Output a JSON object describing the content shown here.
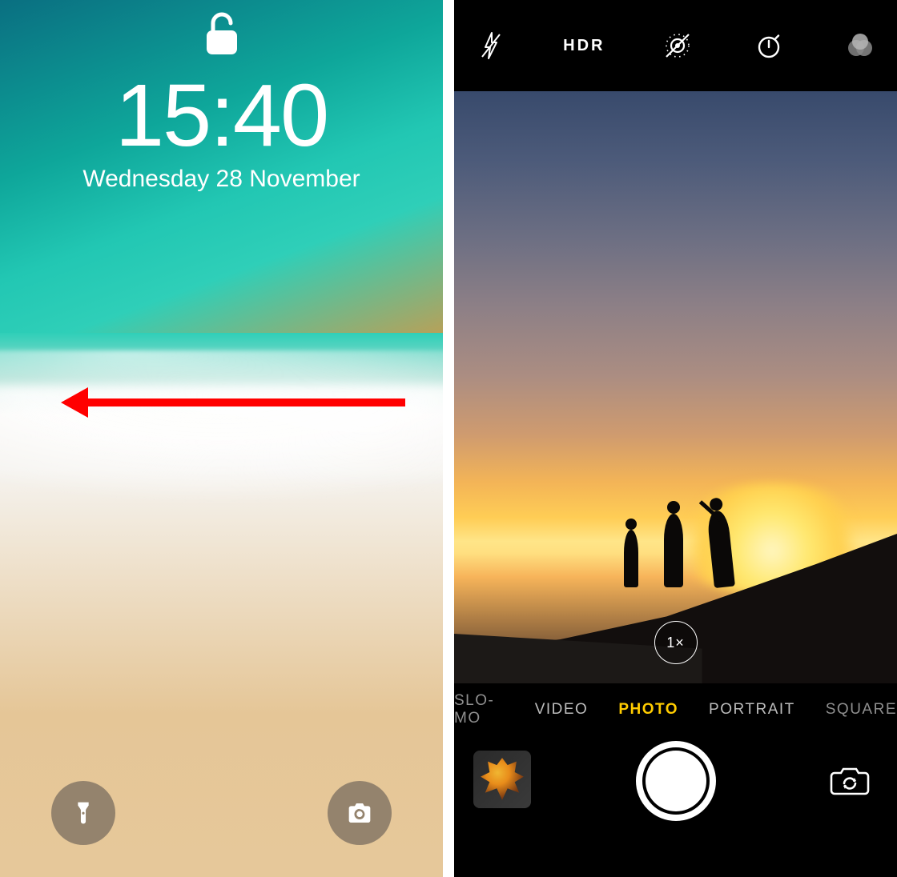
{
  "lockscreen": {
    "time": "15:40",
    "date": "Wednesday 28 November",
    "lock_state": "unlocked",
    "quick_actions": {
      "left": "flashlight",
      "right": "camera"
    },
    "swipe_hint_direction": "left"
  },
  "camera": {
    "topbar": {
      "flash": "off",
      "hdr_label": "HDR",
      "live_photos": "off",
      "timer": "off",
      "filters": "off"
    },
    "zoom_label": "1×",
    "modes": [
      "SLO-MO",
      "VIDEO",
      "PHOTO",
      "PORTRAIT",
      "SQUARE"
    ],
    "active_mode": "PHOTO",
    "controls": {
      "thumbnail": "last-photo",
      "shutter": "shutter",
      "flip": "switch-camera"
    }
  },
  "colors": {
    "accent": "#ffcc00",
    "annotation": "#ff0000"
  }
}
